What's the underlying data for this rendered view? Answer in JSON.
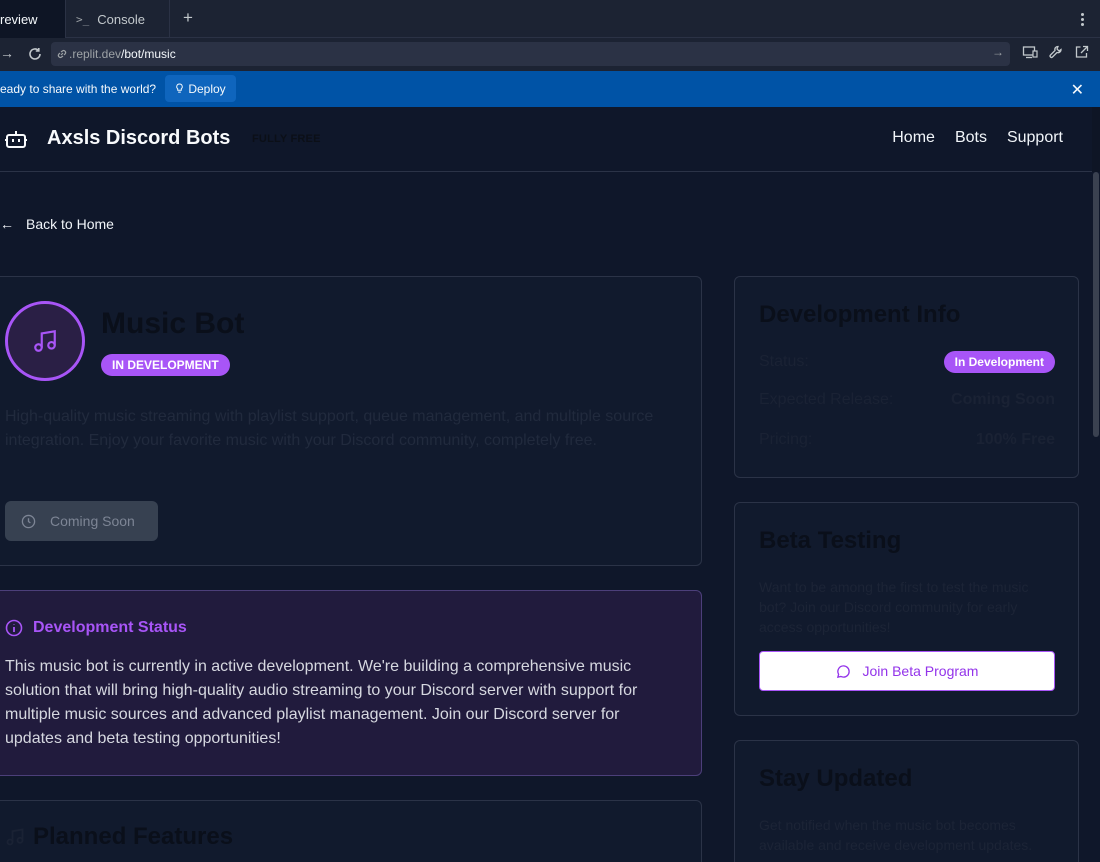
{
  "tabs": {
    "preview_label": "review",
    "console_label": "Console",
    "add_icon": "plus-icon"
  },
  "address": {
    "host": ".replit.dev",
    "path": "/bot/music"
  },
  "banner": {
    "text": "eady to share with the world?",
    "deploy_label": "Deploy"
  },
  "site": {
    "brand": "Axsls Discord Bots",
    "badge": "FULLY FREE",
    "nav": [
      "Home",
      "Bots",
      "Support"
    ]
  },
  "back_label": "Back to Home",
  "hero": {
    "title": "Music Bot",
    "status": "IN DEVELOPMENT",
    "description": "High-quality music streaming with playlist support, queue management, and multiple source integration. Enjoy your favorite music with your Discord community, completely free.",
    "button": "Coming Soon"
  },
  "dev_status": {
    "heading": "Development Status",
    "body": "This music bot is currently in active development. We're building a comprehensive music solution that will bring high-quality audio streaming to your Discord server with support for multiple music sources and advanced playlist management. Join our Discord server for updates and beta testing opportunities!"
  },
  "planned": {
    "heading": "Planned Features"
  },
  "dev_info": {
    "title": "Development Info",
    "rows": [
      {
        "label": "Status:",
        "value": "In Development"
      },
      {
        "label": "Expected Release:",
        "value": "Coming Soon"
      },
      {
        "label": "Pricing:",
        "value": "100% Free"
      }
    ]
  },
  "beta": {
    "title": "Beta Testing",
    "text": "Want to be among the first to test the music bot? Join our Discord community for early access opportunities!",
    "button": "Join Beta Program"
  },
  "updates": {
    "title": "Stay Updated",
    "text": "Get notified when the music bot becomes available and receive development updates."
  },
  "colors": {
    "accent": "#a855f7",
    "banner": "#0053a6",
    "bg": "#0f172a"
  }
}
